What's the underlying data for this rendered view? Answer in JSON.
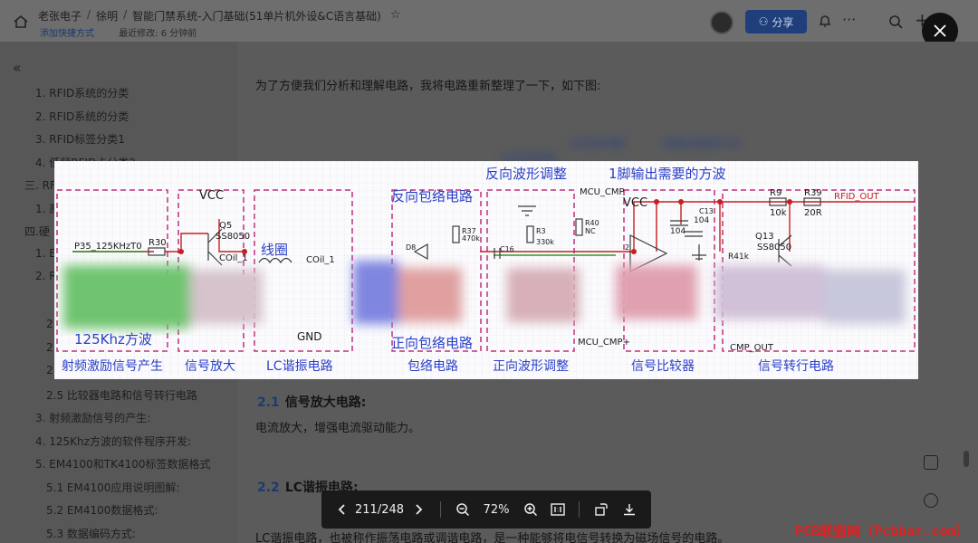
{
  "header": {
    "breadcrumb": [
      "老张电子",
      "徐明",
      "智能门禁系统-入门基础(51单片机外设&C语言基础)"
    ],
    "separator": "/",
    "add_shortcut": "添加快捷方式",
    "last_modified": "最近修改: 6 分钟前",
    "share_label": "分享"
  },
  "sidebar": {
    "items": [
      "1. RFID系统的分类",
      "2. RFID系统的分类",
      "3. RFID标签分类1",
      "4. 低频RFID卡分类2",
      "三. RFID",
      "1. 原",
      "四.硬",
      "1. E",
      "2. R",
      "2",
      "2",
      "2",
      "2.5 比较器电路和信号转行电路",
      "3. 射频激励信号的产生:",
      "4. 125Khz方波的软件程序开发:",
      "5. EM4100和TK4100标签数据格式",
      "5.1 EM4100应用说明图解:",
      "5.2 EM4100数据格式:",
      "5.3 数据编码方式:"
    ]
  },
  "content": {
    "intro": "为了方便我们分析和理解电路，我将电路重新整理了一下，如下图:",
    "section1_num": "2.1",
    "section1_title": "信号放大电路:",
    "section1_text": "电流放大，增强电流驱动能力。",
    "section2_num": "2.2",
    "section2_title": "LC谐振电路:",
    "section2_text": "LC谐振电路，也被称作振荡电路或调谐电路，是一种能够将电信号转换为磁场信号的电路。",
    "bg_labels": [
      "反向波形调整",
      "1脚输出需要的方波",
      "反向包络电路"
    ]
  },
  "circuit": {
    "top_labels": [
      "反向波形调整",
      "1脚输出需要的方波"
    ],
    "blocks": [
      "射频激励信号产生",
      "信号放大",
      "LC谐振电路",
      "包络电路",
      "正向波形调整",
      "信号比较器",
      "信号转行电路"
    ],
    "inner": {
      "vcc": "VCC",
      "q5": "Q5",
      "q5_part": "SS8050",
      "p35": "P35_125KHzT0",
      "r30": "R30",
      "coil": "线圈",
      "coil_label": "COil_1",
      "coil_label2": "COil_1",
      "inverse_env": "反向包络电路",
      "r37": "R37",
      "r37_val": "470k",
      "d8": "D8",
      "mcu_cmp_top": "MCU_CMP",
      "r40": "R40",
      "r40_val": "NC",
      "r3": "R3",
      "r3_val": "330k",
      "c16": "C16",
      "vcc2": "VCC",
      "c104a": "104",
      "c104b": "104",
      "c13": "C13",
      "r9": "R9",
      "r9_val": "10k",
      "r39": "R39",
      "r39_val": "20R",
      "rfid_out": "RFID_OUT",
      "q13": "Q13",
      "q13_part": "SS8050",
      "r41": "R41k",
      "gnd": "GND",
      "wave_125": "125Khz方波",
      "fwd_env": "正向包络电路",
      "mcu_cmp_bottom": "MCU_CMP+",
      "cmp_out": "CMP_OUT",
      "pin2": "2"
    }
  },
  "toolbar": {
    "page": "211/248",
    "zoom": "72%"
  },
  "watermark": "PCB联盟网（Pcbbar.com）",
  "colors": {
    "accent": "#1f3e7a",
    "block_border": "#c0307a",
    "wire": "#c81e1e",
    "title_blue": "#2a3fc8",
    "watermark": "#e02020"
  }
}
